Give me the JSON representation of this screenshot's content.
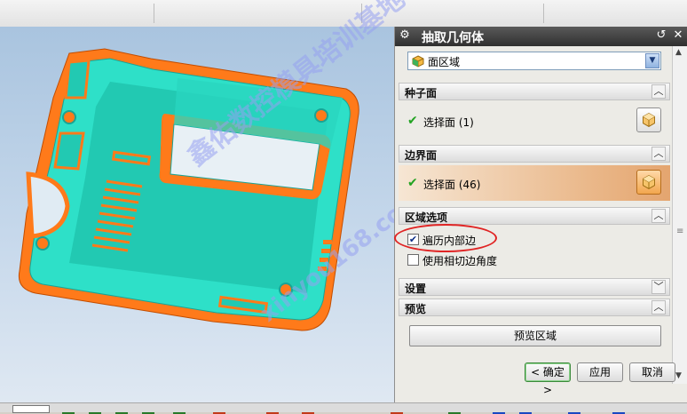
{
  "dialog": {
    "title": "抽取几何体",
    "type_select": {
      "selected": "面区域"
    },
    "sections": {
      "seed_face": {
        "header": "种子面",
        "row_label": "选择面 (1)"
      },
      "boundary_face": {
        "header": "边界面",
        "row_label": "选择面 (46)"
      },
      "region_options": {
        "header": "区域选项",
        "traverse_interior": {
          "label": "遍历内部边",
          "checked": true
        },
        "tangent_angle": {
          "label": "使用相切边角度",
          "checked": false
        }
      },
      "settings": {
        "header": "设置"
      },
      "preview": {
        "header": "预览",
        "button": "预览区域"
      }
    },
    "footer": {
      "ok": "< 确定 >",
      "apply": "应用",
      "cancel": "取消"
    }
  },
  "watermark": {
    "line1": "鑫佑数控模具培训基地",
    "line2": "xinyou168.com"
  },
  "colors": {
    "part_body": "#2ee0c8",
    "part_edge": "#ff7a1a",
    "titlebar": "#3a3a3a",
    "accent_orange": "#e8a060"
  },
  "icons": [
    "gear-icon",
    "reset-icon",
    "close-icon",
    "dropdown-arrow-icon",
    "face-region-icon",
    "checkmark-icon",
    "cube-select-icon",
    "chevron-up-icon",
    "chevron-down-icon"
  ]
}
